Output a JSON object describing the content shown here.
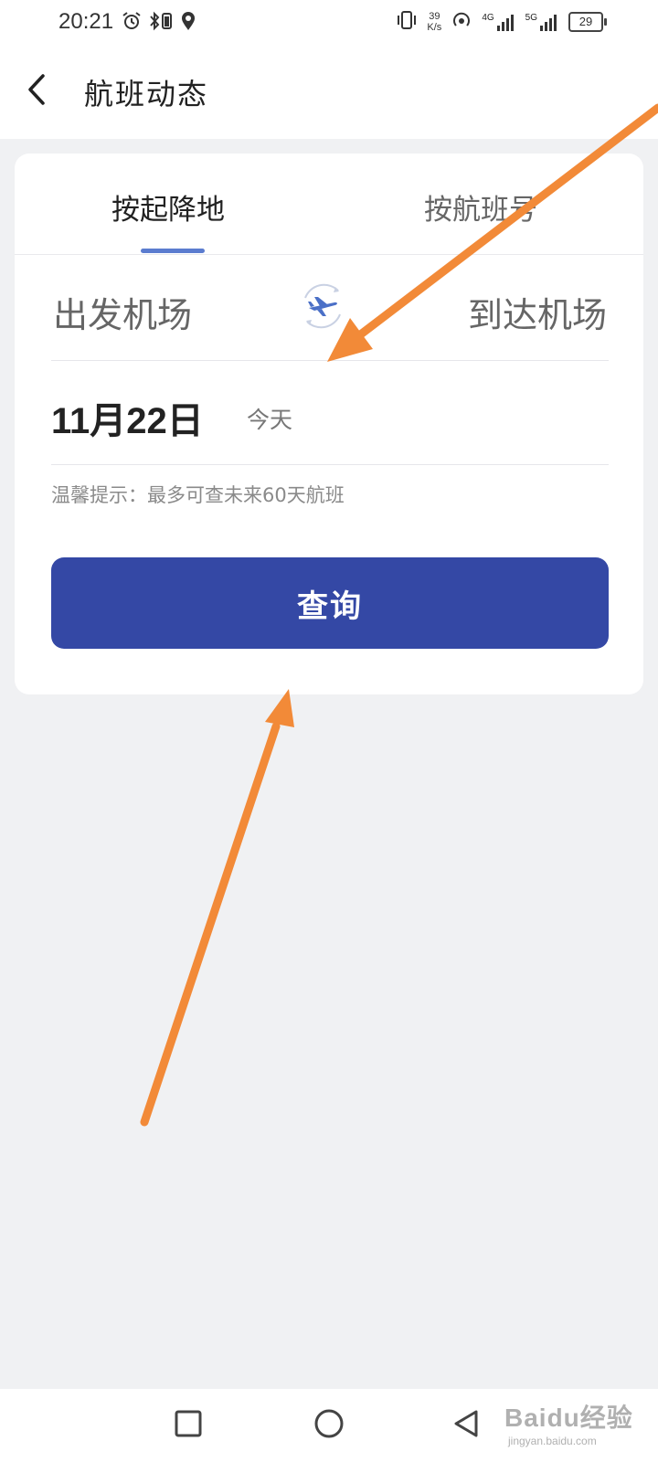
{
  "status_bar": {
    "time": "20:21",
    "network_speed_value": "39",
    "network_speed_unit": "K/s",
    "network_type_1": "4G",
    "network_type_2": "5G",
    "battery": "29"
  },
  "header": {
    "title": "航班动态"
  },
  "search_card": {
    "tabs": [
      {
        "label": "按起降地",
        "active": true
      },
      {
        "label": "按航班号",
        "active": false
      }
    ],
    "departure_placeholder": "出发机场",
    "arrival_placeholder": "到达机场",
    "date": "11月22日",
    "date_note": "今天",
    "tip": "温馨提示：最多可查未来60天航班",
    "query_button": "查询"
  },
  "colors": {
    "accent": "#3448a5",
    "tab_indicator": "#5b7ccf",
    "background": "#f0f1f3",
    "annotation_arrow": "#f28a38"
  },
  "icons": {
    "back": "chevron-left-icon",
    "swap": "plane-swap-icon",
    "nav_recents": "square-icon",
    "nav_home": "circle-icon",
    "nav_back": "triangle-back-icon"
  },
  "watermark": {
    "logo_text": "Baidu经验",
    "url": "jingyan.baidu.com"
  }
}
